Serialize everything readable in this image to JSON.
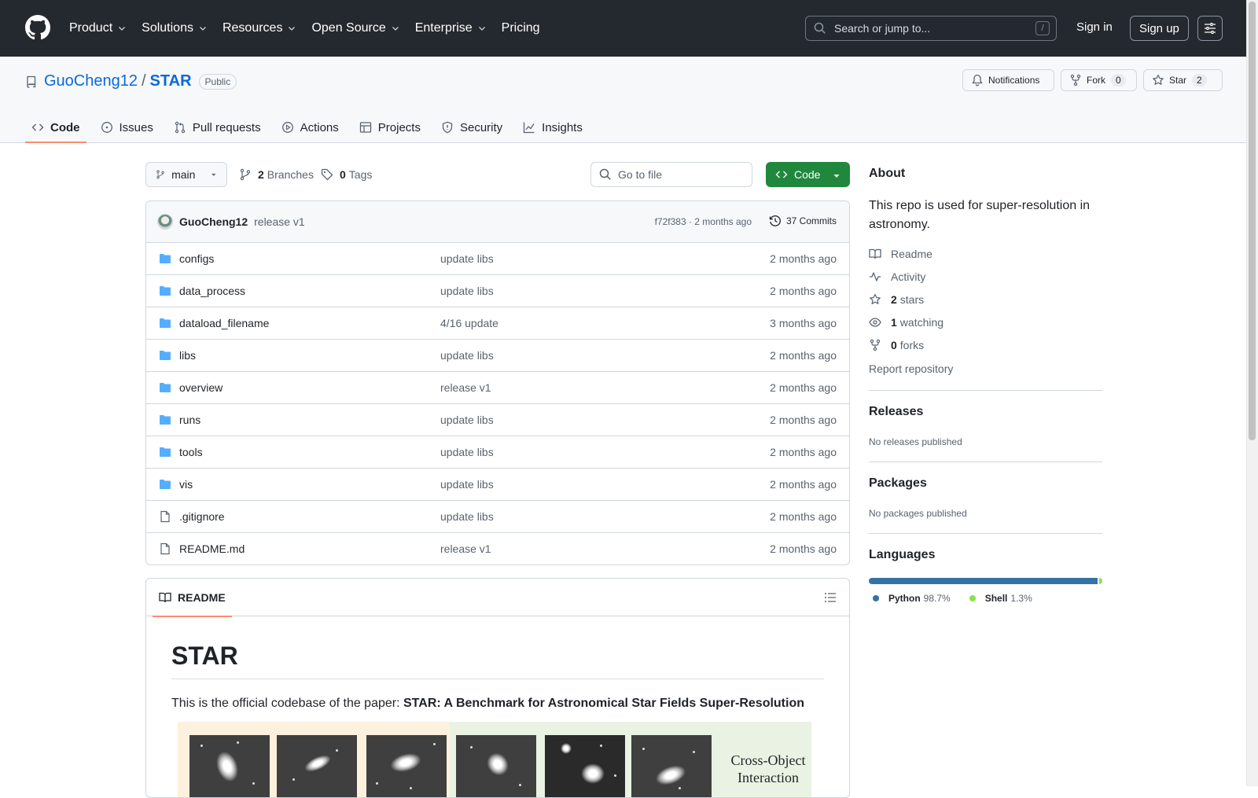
{
  "header": {
    "nav": [
      "Product",
      "Solutions",
      "Resources",
      "Open Source",
      "Enterprise",
      "Pricing"
    ],
    "search_placeholder": "Search or jump to...",
    "search_shortcut": "/",
    "signin": "Sign in",
    "signup": "Sign up"
  },
  "repo": {
    "owner": "GuoCheng12",
    "separator": "/",
    "name": "STAR",
    "visibility": "Public",
    "notifications_label": "Notifications",
    "fork_label": "Fork",
    "fork_count": "0",
    "star_label": "Star",
    "star_count": "2",
    "tabs": [
      "Code",
      "Issues",
      "Pull requests",
      "Actions",
      "Projects",
      "Security",
      "Insights"
    ]
  },
  "toolbar": {
    "branch": "main",
    "branches_count": "2",
    "branches_label": "Branches",
    "tags_count": "0",
    "tags_label": "Tags",
    "goto_placeholder": "Go to file",
    "code_button": "Code"
  },
  "commit": {
    "author": "GuoCheng12",
    "message": "release v1",
    "meta": "f72f383 · 2 months ago",
    "commits": "37 Commits"
  },
  "files": [
    {
      "name": "configs",
      "type": "dir",
      "message": "update libs",
      "time": "2 months ago"
    },
    {
      "name": "data_process",
      "type": "dir",
      "message": "update libs",
      "time": "2 months ago"
    },
    {
      "name": "dataload_filename",
      "type": "dir",
      "message": "4/16 update",
      "time": "3 months ago"
    },
    {
      "name": "libs",
      "type": "dir",
      "message": "update libs",
      "time": "2 months ago"
    },
    {
      "name": "overview",
      "type": "dir",
      "message": "release v1",
      "time": "2 months ago"
    },
    {
      "name": "runs",
      "type": "dir",
      "message": "update libs",
      "time": "2 months ago"
    },
    {
      "name": "tools",
      "type": "dir",
      "message": "update libs",
      "time": "2 months ago"
    },
    {
      "name": "vis",
      "type": "dir",
      "message": "update libs",
      "time": "2 months ago"
    },
    {
      "name": ".gitignore",
      "type": "file",
      "message": "update libs",
      "time": "2 months ago"
    },
    {
      "name": "README.md",
      "type": "file",
      "message": "release v1",
      "time": "2 months ago"
    }
  ],
  "readme": {
    "tab": "README",
    "title": "STAR",
    "intro": "This is the official codebase of the paper: ",
    "paper": "STAR: A Benchmark for Astronomical Star Fields Super-Resolution",
    "figure_label_line1": "Cross-Object",
    "figure_label_line2": "Interaction"
  },
  "about": {
    "heading": "About",
    "description": "This repo is used for super-resolution in astronomy.",
    "readme": "Readme",
    "activity": "Activity",
    "stars_count": "2",
    "stars_label": "stars",
    "watching_count": "1",
    "watching_label": "watching",
    "forks_count": "0",
    "forks_label": "forks",
    "report": "Report repository"
  },
  "releases": {
    "heading": "Releases",
    "note": "No releases published"
  },
  "packages": {
    "heading": "Packages",
    "note": "No packages published"
  },
  "languages": {
    "heading": "Languages",
    "items": [
      {
        "name": "Python",
        "percent": "98.7%",
        "value": 98.7,
        "color": "#3572A5"
      },
      {
        "name": "Shell",
        "percent": "1.3%",
        "value": 1.3,
        "color": "#89e051"
      }
    ]
  }
}
